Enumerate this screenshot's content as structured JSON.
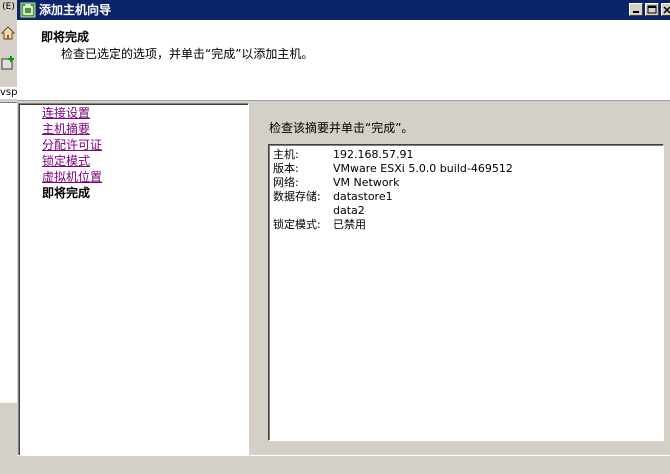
{
  "background_app": {
    "menu_glyph": "(E)",
    "tree_fragment_text": "vsp"
  },
  "dialog": {
    "title": "添加主机向导",
    "step_title": "即将完成",
    "step_description": "检查已选定的选项，并单击“完成”以添加主机。"
  },
  "nav": {
    "items": [
      {
        "label": "连接设置"
      },
      {
        "label": "主机摘要"
      },
      {
        "label": "分配许可证"
      },
      {
        "label": "锁定模式"
      },
      {
        "label": "虚拟机位置"
      },
      {
        "label": "即将完成"
      }
    ]
  },
  "content": {
    "instruction": "检查该摘要并单击“完成”。",
    "summary": {
      "host_label": "主机:",
      "host_value": "192.168.57.91",
      "version_label": "版本:",
      "version_value": "VMware ESXi 5.0.0 build-469512",
      "network_label": "网络:",
      "network_value": "VM Network",
      "datastore_label": "数据存储:",
      "datastore_values": [
        "datastore1",
        "data2"
      ],
      "lockdown_label": "锁定模式:",
      "lockdown_value": "已禁用"
    }
  },
  "colors": {
    "title_bar": "#0a246a",
    "visited_link": "#800080",
    "window_face": "#d4d0c8"
  }
}
